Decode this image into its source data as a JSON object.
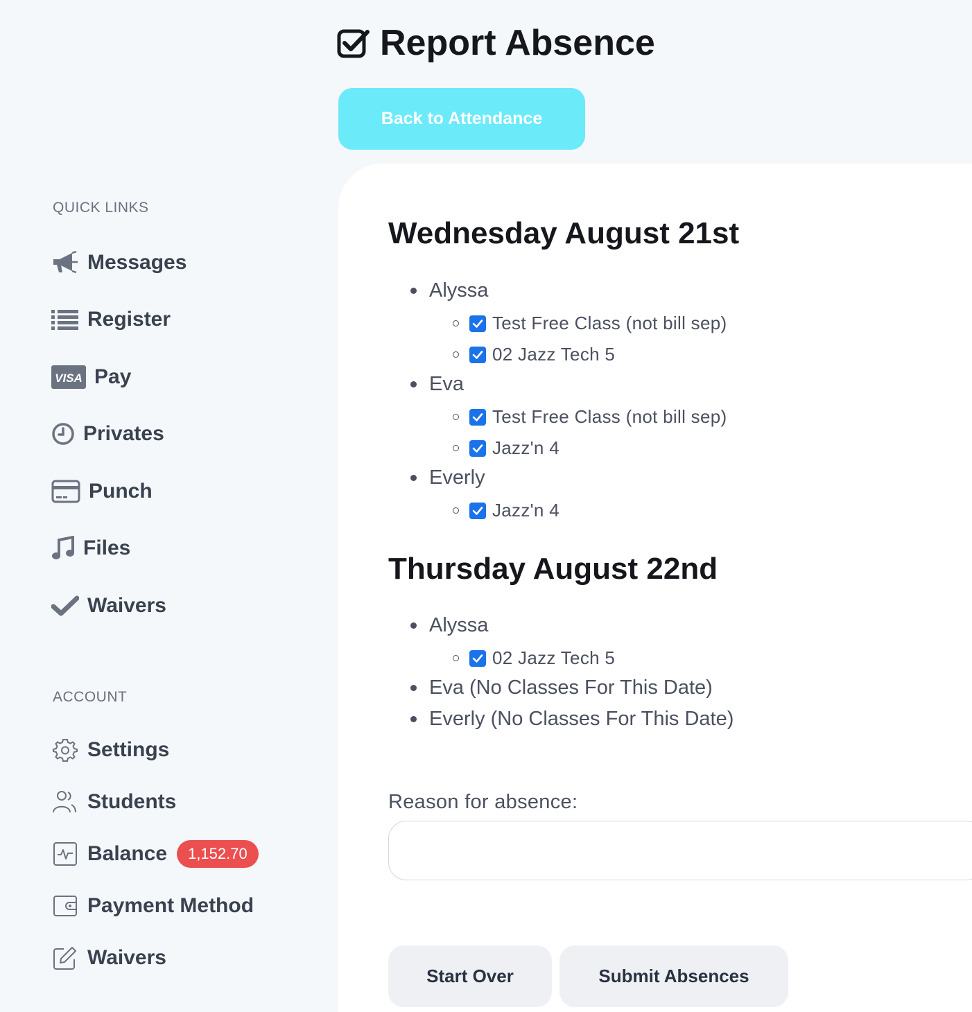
{
  "header": {
    "title": "Report Absence",
    "title_icon": "checkbox-icon",
    "back_button": "Back to Attendance"
  },
  "sidebar": {
    "quick_links_label": "QUICK LINKS",
    "quick_links": [
      {
        "label": "Messages",
        "icon": "megaphone-icon"
      },
      {
        "label": "Register",
        "icon": "list-icon"
      },
      {
        "label": "Pay",
        "icon": "visa-card-icon",
        "icon_text": "VISA"
      },
      {
        "label": "Privates",
        "icon": "clock-icon"
      },
      {
        "label": "Punch",
        "icon": "credit-card-icon"
      },
      {
        "label": "Files",
        "icon": "music-note-icon"
      },
      {
        "label": "Waivers",
        "icon": "checkmark-icon"
      }
    ],
    "account_label": "ACCOUNT",
    "account_links": [
      {
        "label": "Settings",
        "icon": "gear-icon"
      },
      {
        "label": "Students",
        "icon": "users-icon"
      },
      {
        "label": "Balance",
        "icon": "activity-icon",
        "badge": "1,152.70"
      },
      {
        "label": "Payment Method",
        "icon": "wallet-icon"
      },
      {
        "label": "Waivers",
        "icon": "edit-icon"
      }
    ]
  },
  "days": [
    {
      "heading": "Wednesday August 21st",
      "students": [
        {
          "name": "Alyssa",
          "classes": [
            {
              "label": "Test Free Class (not bill sep)",
              "checked": true
            },
            {
              "label": "02 Jazz Tech 5",
              "checked": true
            }
          ]
        },
        {
          "name": "Eva",
          "classes": [
            {
              "label": "Test Free Class (not bill sep)",
              "checked": true
            },
            {
              "label": "Jazz'n 4",
              "checked": true
            }
          ]
        },
        {
          "name": "Everly",
          "classes": [
            {
              "label": "Jazz'n 4",
              "checked": true
            }
          ]
        }
      ]
    },
    {
      "heading": "Thursday August 22nd",
      "students": [
        {
          "name": "Alyssa",
          "classes": [
            {
              "label": "02 Jazz Tech 5",
              "checked": true
            }
          ]
        },
        {
          "name": "Eva (No Classes For This Date)",
          "classes": []
        },
        {
          "name": "Everly (No Classes For This Date)",
          "classes": []
        }
      ]
    }
  ],
  "reason": {
    "label": "Reason for absence:",
    "value": ""
  },
  "actions": {
    "start_over": "Start Over",
    "submit": "Submit Absences"
  },
  "colors": {
    "accent": "#6beafa",
    "checkbox": "#1a73e8",
    "badge": "#ec4f4f",
    "background": "#f5f8fb"
  }
}
